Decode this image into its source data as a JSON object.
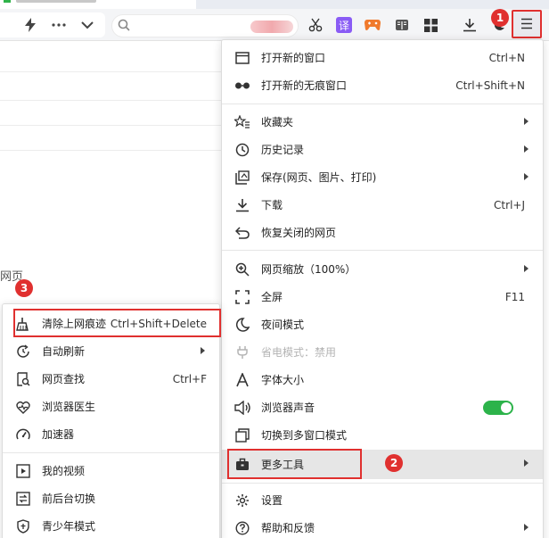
{
  "browser": {
    "addr_placeholder": "",
    "toolbar_icons": [
      "lightning-icon",
      "more-icon",
      "chevron-down-icon",
      "search-icon",
      "scissors-icon",
      "translate-icon",
      "game-icon",
      "reader-icon",
      "apps-icon",
      "download-icon",
      "moon-icon",
      "menu-icon"
    ],
    "translate_glyph": "译"
  },
  "page": {
    "partial_text": "网页"
  },
  "badges": {
    "one": "1",
    "two": "2",
    "three": "3"
  },
  "menu": {
    "items": [
      {
        "label": "打开新的窗口",
        "shortcut": "Ctrl+N",
        "icon": "window-icon"
      },
      {
        "label": "打开新的无痕窗口",
        "shortcut": "Ctrl+Shift+N",
        "icon": "incognito-icon"
      },
      {
        "label": "收藏夹",
        "shortcut": "",
        "icon": "star-list-icon",
        "submenu": true
      },
      {
        "label": "历史记录",
        "shortcut": "",
        "icon": "clock-icon",
        "submenu": true
      },
      {
        "label": "保存(网页、图片、打印)",
        "shortcut": "",
        "icon": "save-icon",
        "submenu": true
      },
      {
        "label": "下载",
        "shortcut": "Ctrl+J",
        "icon": "download-icon"
      },
      {
        "label": "恢复关闭的网页",
        "shortcut": "",
        "icon": "undo-icon"
      },
      {
        "label": "网页缩放（100%）",
        "shortcut": "",
        "icon": "zoom-icon",
        "submenu": true
      },
      {
        "label": "全屏",
        "shortcut": "F11",
        "icon": "fullscreen-icon"
      },
      {
        "label": "夜间模式",
        "shortcut": "",
        "icon": "moon-icon"
      },
      {
        "label": "省电模式：禁用",
        "shortcut": "",
        "icon": "plug-icon",
        "disabled": true
      },
      {
        "label": "字体大小",
        "shortcut": "",
        "icon": "font-size-icon"
      },
      {
        "label": "浏览器声音",
        "shortcut": "",
        "icon": "speaker-icon",
        "toggle": true
      },
      {
        "label": "切换到多窗口模式",
        "shortcut": "",
        "icon": "multi-window-icon"
      },
      {
        "label": "更多工具",
        "shortcut": "",
        "icon": "toolbox-icon",
        "submenu": true,
        "highlighted": true
      },
      {
        "label": "设置",
        "shortcut": "",
        "icon": "gear-icon"
      },
      {
        "label": "帮助和反馈",
        "shortcut": "",
        "icon": "help-icon",
        "submenu": true
      }
    ]
  },
  "submenu": {
    "items": [
      {
        "label": "清除上网痕迹",
        "shortcut": "Ctrl+Shift+Delete",
        "icon": "broom-icon"
      },
      {
        "label": "自动刷新",
        "shortcut": "",
        "icon": "refresh-clock-icon",
        "submenu": true
      },
      {
        "label": "网页查找",
        "shortcut": "Ctrl+F",
        "icon": "find-icon"
      },
      {
        "label": "浏览器医生",
        "shortcut": "",
        "icon": "doctor-icon"
      },
      {
        "label": "加速器",
        "shortcut": "",
        "icon": "speedometer-icon"
      },
      {
        "label": "我的视频",
        "shortcut": "",
        "icon": "video-icon"
      },
      {
        "label": "前后台切换",
        "shortcut": "",
        "icon": "switch-icon"
      },
      {
        "label": "青少年模式",
        "shortcut": "",
        "icon": "shield-icon"
      }
    ]
  },
  "colors": {
    "accent_red": "#e0302f",
    "toggle_green": "#2cb34a"
  }
}
